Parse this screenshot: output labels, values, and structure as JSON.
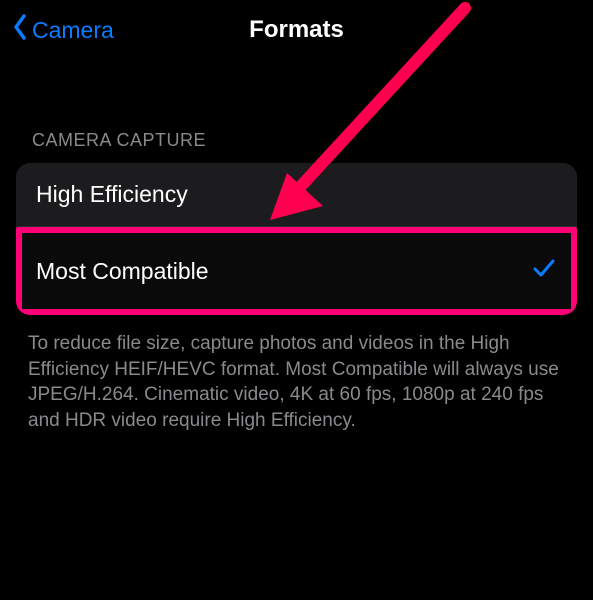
{
  "nav": {
    "back_label": "Camera",
    "title": "Formats"
  },
  "section": {
    "header": "CAMERA CAPTURE",
    "options": [
      {
        "label": "High Efficiency",
        "selected": false
      },
      {
        "label": "Most Compatible",
        "selected": true
      }
    ],
    "footer": "To reduce file size, capture photos and videos in the High Efficiency HEIF/HEVC format. Most Compatible will always use JPEG/H.264. Cinematic video, 4K at 60 fps, 1080p at 240 fps and HDR video require High Efficiency."
  },
  "annotation": {
    "arrow_color": "#ff0050"
  }
}
